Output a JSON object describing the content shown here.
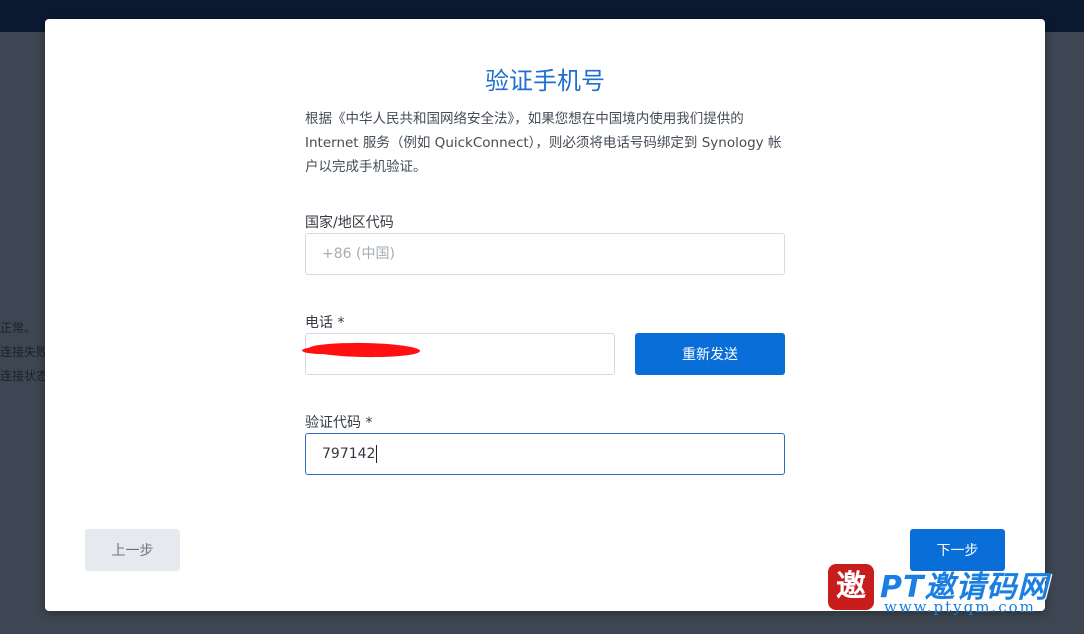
{
  "background": {
    "lines": [
      "正常。",
      "连接失败",
      "连接状态"
    ]
  },
  "dialog": {
    "title": "验证手机号",
    "description": "根据《中华人民共和国网络安全法》，如果您想在中国境内使用我们提供的 Internet 服务（例如 QuickConnect），则必须将电话号码绑定到 Synology 帐户以完成手机验证。",
    "country_code": {
      "label": "国家/地区代码",
      "placeholder": "+86 (中国)"
    },
    "phone": {
      "label": "电话 *",
      "value": "",
      "resend_label": "重新发送"
    },
    "verification_code": {
      "label": "验证代码 *",
      "value": "797142"
    },
    "back_label": "上一步",
    "next_label": "下一步"
  },
  "watermark": {
    "seal_char": "邀",
    "text": "PT邀请码网",
    "url": "www.ptyqm.com"
  },
  "colors": {
    "accent": "#0a6ed8",
    "title": "#1e6fd0",
    "redaction": "#ff1010"
  }
}
